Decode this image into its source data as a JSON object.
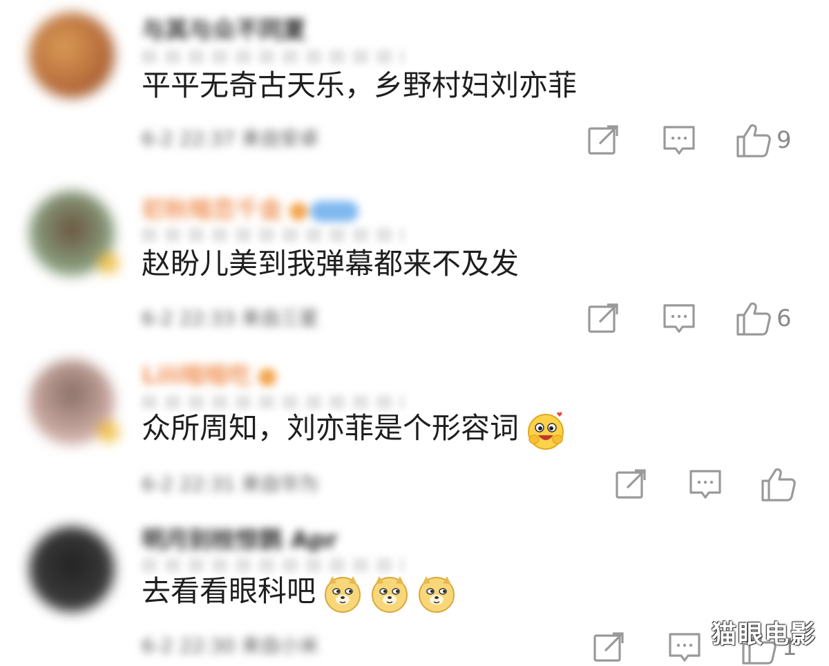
{
  "comments": [
    {
      "username": "与其与众不同夏",
      "content": "平平无奇古天乐，乡野村妇刘亦菲",
      "meta": "6-2 22:37 来自安卓",
      "like_count": "9",
      "avatar_color": "#c9824a"
    },
    {
      "username": "初秋暗恋千金",
      "content": "赵盼儿美到我弹幕都来不及发",
      "meta": "6-2 22:33 来自三星",
      "like_count": "6",
      "avatar_color": "#6e5a45"
    },
    {
      "username": "Lili暗暗吃",
      "content": "众所周知，刘亦菲是个形容词",
      "meta": "6-2 22:31 来自华为",
      "like_count": "",
      "avatar_color": "#9a7a70"
    },
    {
      "username": "明月别枝惊鹊 Apr",
      "content": "去看看眼科吧",
      "meta": "6-2 22:30 来自小米",
      "like_count": "1",
      "avatar_color": "#3a3a3a"
    }
  ],
  "watermark": "猫眼电影",
  "icons": {
    "share": "share-icon",
    "comment": "comment-icon",
    "like": "thumbs-up-icon"
  }
}
